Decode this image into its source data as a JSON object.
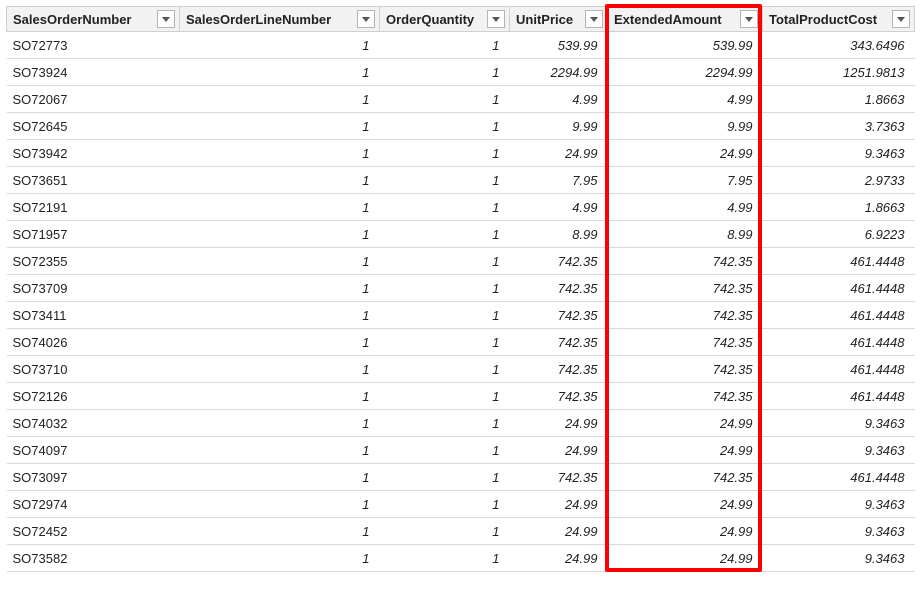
{
  "columns": [
    {
      "key": "SalesOrderNumber",
      "label": "SalesOrderNumber",
      "type": "txt"
    },
    {
      "key": "SalesOrderLineNumber",
      "label": "SalesOrderLineNumber",
      "type": "num"
    },
    {
      "key": "OrderQuantity",
      "label": "OrderQuantity",
      "type": "num"
    },
    {
      "key": "UnitPrice",
      "label": "UnitPrice",
      "type": "num"
    },
    {
      "key": "ExtendedAmount",
      "label": "ExtendedAmount",
      "type": "num"
    },
    {
      "key": "TotalProductCost",
      "label": "TotalProductCost",
      "type": "num"
    }
  ],
  "highlighted_column_index": 4,
  "rows": [
    {
      "SalesOrderNumber": "SO72773",
      "SalesOrderLineNumber": "1",
      "OrderQuantity": "1",
      "UnitPrice": "539.99",
      "ExtendedAmount": "539.99",
      "TotalProductCost": "343.6496"
    },
    {
      "SalesOrderNumber": "SO73924",
      "SalesOrderLineNumber": "1",
      "OrderQuantity": "1",
      "UnitPrice": "2294.99",
      "ExtendedAmount": "2294.99",
      "TotalProductCost": "1251.9813"
    },
    {
      "SalesOrderNumber": "SO72067",
      "SalesOrderLineNumber": "1",
      "OrderQuantity": "1",
      "UnitPrice": "4.99",
      "ExtendedAmount": "4.99",
      "TotalProductCost": "1.8663"
    },
    {
      "SalesOrderNumber": "SO72645",
      "SalesOrderLineNumber": "1",
      "OrderQuantity": "1",
      "UnitPrice": "9.99",
      "ExtendedAmount": "9.99",
      "TotalProductCost": "3.7363"
    },
    {
      "SalesOrderNumber": "SO73942",
      "SalesOrderLineNumber": "1",
      "OrderQuantity": "1",
      "UnitPrice": "24.99",
      "ExtendedAmount": "24.99",
      "TotalProductCost": "9.3463"
    },
    {
      "SalesOrderNumber": "SO73651",
      "SalesOrderLineNumber": "1",
      "OrderQuantity": "1",
      "UnitPrice": "7.95",
      "ExtendedAmount": "7.95",
      "TotalProductCost": "2.9733"
    },
    {
      "SalesOrderNumber": "SO72191",
      "SalesOrderLineNumber": "1",
      "OrderQuantity": "1",
      "UnitPrice": "4.99",
      "ExtendedAmount": "4.99",
      "TotalProductCost": "1.8663"
    },
    {
      "SalesOrderNumber": "SO71957",
      "SalesOrderLineNumber": "1",
      "OrderQuantity": "1",
      "UnitPrice": "8.99",
      "ExtendedAmount": "8.99",
      "TotalProductCost": "6.9223"
    },
    {
      "SalesOrderNumber": "SO72355",
      "SalesOrderLineNumber": "1",
      "OrderQuantity": "1",
      "UnitPrice": "742.35",
      "ExtendedAmount": "742.35",
      "TotalProductCost": "461.4448"
    },
    {
      "SalesOrderNumber": "SO73709",
      "SalesOrderLineNumber": "1",
      "OrderQuantity": "1",
      "UnitPrice": "742.35",
      "ExtendedAmount": "742.35",
      "TotalProductCost": "461.4448"
    },
    {
      "SalesOrderNumber": "SO73411",
      "SalesOrderLineNumber": "1",
      "OrderQuantity": "1",
      "UnitPrice": "742.35",
      "ExtendedAmount": "742.35",
      "TotalProductCost": "461.4448"
    },
    {
      "SalesOrderNumber": "SO74026",
      "SalesOrderLineNumber": "1",
      "OrderQuantity": "1",
      "UnitPrice": "742.35",
      "ExtendedAmount": "742.35",
      "TotalProductCost": "461.4448"
    },
    {
      "SalesOrderNumber": "SO73710",
      "SalesOrderLineNumber": "1",
      "OrderQuantity": "1",
      "UnitPrice": "742.35",
      "ExtendedAmount": "742.35",
      "TotalProductCost": "461.4448"
    },
    {
      "SalesOrderNumber": "SO72126",
      "SalesOrderLineNumber": "1",
      "OrderQuantity": "1",
      "UnitPrice": "742.35",
      "ExtendedAmount": "742.35",
      "TotalProductCost": "461.4448"
    },
    {
      "SalesOrderNumber": "SO74032",
      "SalesOrderLineNumber": "1",
      "OrderQuantity": "1",
      "UnitPrice": "24.99",
      "ExtendedAmount": "24.99",
      "TotalProductCost": "9.3463"
    },
    {
      "SalesOrderNumber": "SO74097",
      "SalesOrderLineNumber": "1",
      "OrderQuantity": "1",
      "UnitPrice": "24.99",
      "ExtendedAmount": "24.99",
      "TotalProductCost": "9.3463"
    },
    {
      "SalesOrderNumber": "SO73097",
      "SalesOrderLineNumber": "1",
      "OrderQuantity": "1",
      "UnitPrice": "742.35",
      "ExtendedAmount": "742.35",
      "TotalProductCost": "461.4448"
    },
    {
      "SalesOrderNumber": "SO72974",
      "SalesOrderLineNumber": "1",
      "OrderQuantity": "1",
      "UnitPrice": "24.99",
      "ExtendedAmount": "24.99",
      "TotalProductCost": "9.3463"
    },
    {
      "SalesOrderNumber": "SO72452",
      "SalesOrderLineNumber": "1",
      "OrderQuantity": "1",
      "UnitPrice": "24.99",
      "ExtendedAmount": "24.99",
      "TotalProductCost": "9.3463"
    },
    {
      "SalesOrderNumber": "SO73582",
      "SalesOrderLineNumber": "1",
      "OrderQuantity": "1",
      "UnitPrice": "24.99",
      "ExtendedAmount": "24.99",
      "TotalProductCost": "9.3463"
    }
  ]
}
